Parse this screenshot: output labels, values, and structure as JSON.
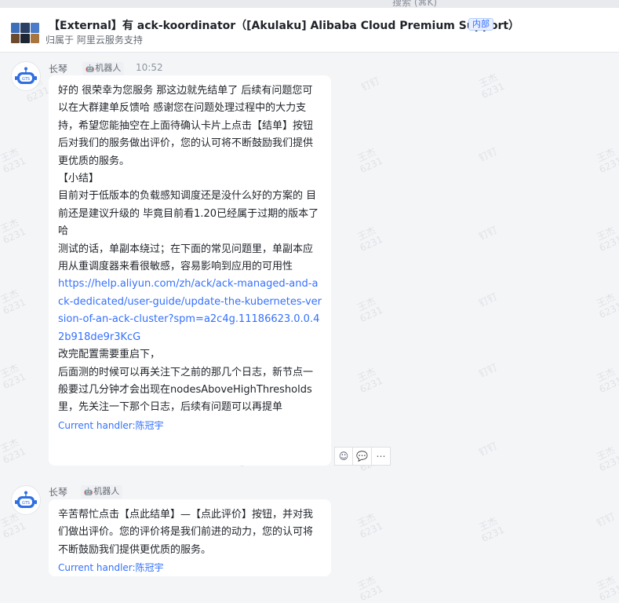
{
  "header": {
    "search_text": "搜索 (⌘K)",
    "title": "【External】有 ack-koordinator（[Akulaku] Alibaba Cloud Premium Support）",
    "badge": "内部",
    "subtitle": "归属于 阿里云服务支持"
  },
  "messages": [
    {
      "sender": "长琴",
      "tag": "机器人",
      "time": "10:52",
      "paragraphs": [
        "好的 很荣幸为您服务 那这边就先结单了 后续有问题您可以在大群建单反馈哈 感谢您在问题处理过程中的大力支持，希望您能抽空在上面待确认卡片上点击【结单】按钮后对我们的服务做出评价，您的认可将不断鼓励我们提供更优质的服务。",
        "【小结】",
        "目前对于低版本的负载感知调度还是没什么好的方案的 目前还是建议升级的 毕竟目前看1.20已经属于过期的版本了哈",
        "测试的话，单副本绕过；在下面的常见问题里，单副本应用从重调度器来看很敏感，容易影响到应用的可用性"
      ],
      "link": "https://help.aliyun.com/zh/ack/ack-managed-and-ack-dedicated/user-guide/update-the-kubernetes-version-of-an-ack-cluster?spm=a2c4g.11186623.0.0.42b918de9r3KcG",
      "after_link": [
        "改完配置需要重启下，",
        "后面测的时候可以再关注下之前的那几个日志，新节点一般要过几分钟才会出现在nodesAboveHighThresholds里，先关注一下那个日志，后续有问题可以再提单"
      ],
      "handler": "Current handler:陈冠宇"
    },
    {
      "sender": "长琴",
      "tag": "机器人",
      "paragraphs": [
        "辛苦帮忙点击【点此结单】—【点此评价】按钮，并对我们做出评价。您的评价将是我们前进的动力，您的认可将不断鼓励我们提供更优质的服务。"
      ],
      "handler": "Current handler:陈冠宇"
    }
  ],
  "actions": [
    {
      "icon": "add-reaction-icon",
      "glyph": "☺"
    },
    {
      "icon": "reply-icon",
      "glyph": "💬"
    },
    {
      "icon": "more-icon",
      "glyph": "⋯"
    }
  ],
  "watermark": {
    "name": "王杰",
    "id": "6231",
    "brand": "钉钉"
  },
  "colors": {
    "accent": "#3370ff",
    "bubble": "#ffffff",
    "background": "#f4f5f7"
  }
}
